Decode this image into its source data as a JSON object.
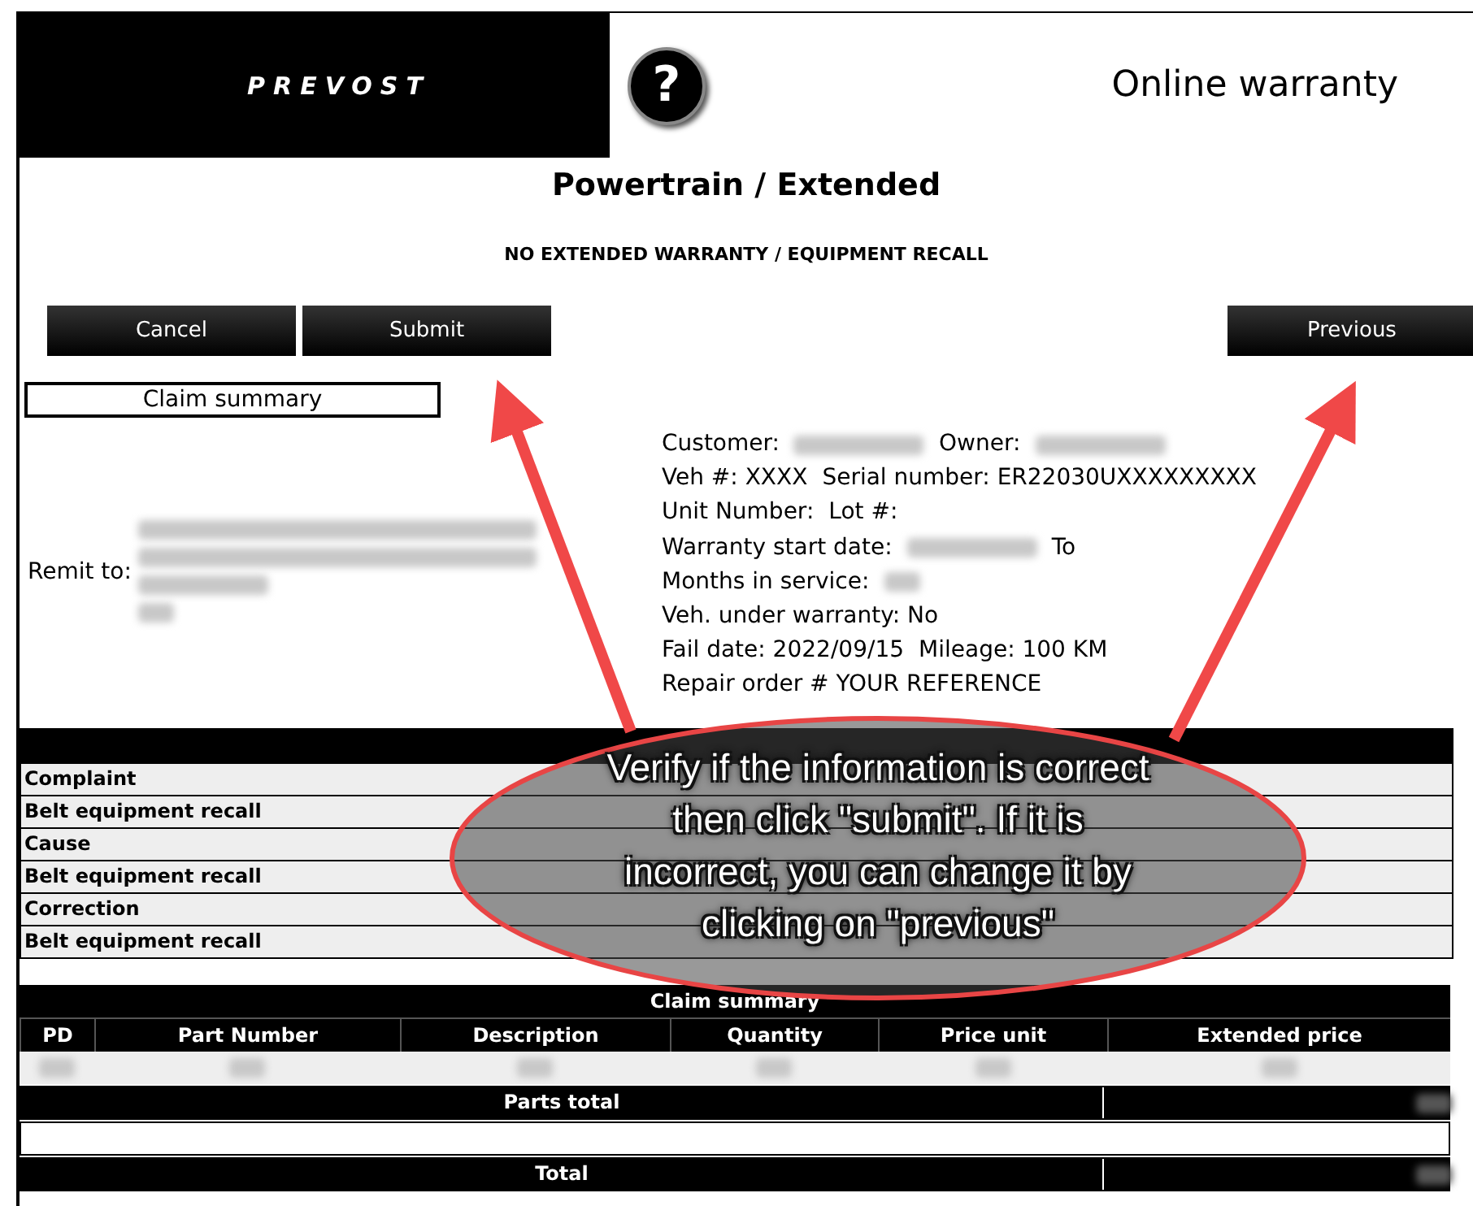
{
  "header": {
    "logo_text": "PREVOST",
    "help_button": "?",
    "title": "Online warranty"
  },
  "page_title": "Powertrain / Extended",
  "subtitle": "NO EXTENDED WARRANTY / EQUIPMENT RECALL",
  "buttons": [
    {
      "label": "Cancel"
    },
    {
      "label": "Submit"
    },
    {
      "label": "Previous"
    }
  ],
  "summary_label": "Claim summary",
  "remit": {
    "label": "Remit to:",
    "lines": [
      {
        "kind": "redacted"
      },
      {
        "kind": "redacted"
      },
      {
        "kind": "redacted"
      },
      {
        "kind": "redacted"
      }
    ]
  },
  "info_lines": [
    [
      {
        "kind": "text",
        "text": "Customer:"
      },
      {
        "kind": "redacted"
      },
      {
        "kind": "text",
        "text": "Owner:"
      },
      {
        "kind": "redacted"
      }
    ],
    [
      {
        "kind": "text",
        "text": "Veh #:  XXXX"
      },
      {
        "kind": "text",
        "text": "Serial number:  ER22030UXXXXXXXXX"
      }
    ],
    [
      {
        "kind": "text",
        "text": "Unit Number:"
      },
      {
        "kind": "text",
        "text": "Lot #:"
      }
    ],
    [
      {
        "kind": "text",
        "text": "Warranty start date:"
      },
      {
        "kind": "redacted"
      },
      {
        "kind": "text",
        "text": "To"
      }
    ],
    [
      {
        "kind": "text",
        "text": "Months in service:"
      },
      {
        "kind": "redacted"
      }
    ],
    [
      {
        "kind": "text",
        "text": "Veh. under warranty:  No"
      }
    ],
    [
      {
        "kind": "text",
        "text": "Fail date:  2022/09/15"
      },
      {
        "kind": "text",
        "text": "Mileage:  100 KM"
      }
    ],
    [
      {
        "kind": "text",
        "text": "Repair order #  YOUR REFERENCE"
      }
    ]
  ],
  "sections": [
    "Complaint",
    "Belt equipment recall",
    "Cause",
    "Belt equipment recall",
    "Correction",
    "Belt equipment recall"
  ],
  "claim_table": {
    "title": "Claim summary",
    "columns": [
      "PD",
      "Part Number",
      "Description",
      "Quantity",
      "Price unit",
      "Extended price"
    ],
    "rows": [
      {
        "cells": [
          {
            "kind": "redacted"
          },
          {
            "kind": "redacted"
          },
          {
            "kind": "redacted"
          },
          {
            "kind": "redacted"
          },
          {
            "kind": "redacted"
          },
          {
            "kind": "redacted"
          }
        ]
      }
    ],
    "totals": [
      {
        "kind": "labeled",
        "label": "Parts total"
      },
      {
        "kind": "blank"
      },
      {
        "kind": "labeled",
        "label": "Total"
      }
    ]
  },
  "callout": {
    "text": "Verify if the information is correct then click \"submit\". If it is incorrect, you can change it by clicking on \"previous\""
  }
}
